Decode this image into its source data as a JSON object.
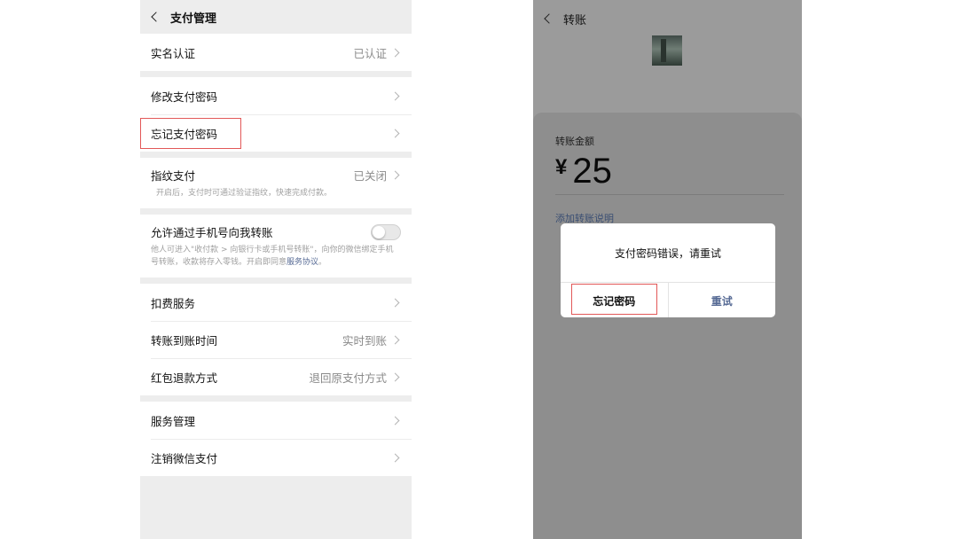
{
  "left": {
    "title": "支付管理",
    "groups": [
      {
        "rows": [
          {
            "label": "实名认证",
            "value": "已认证"
          }
        ]
      },
      {
        "rows": [
          {
            "label": "修改支付密码",
            "value": ""
          },
          {
            "label": "忘记支付密码",
            "value": ""
          }
        ]
      },
      {
        "rows": [
          {
            "label": "指纹支付",
            "value": "已关闭",
            "desc": "开启后，支付时可通过验证指纹，快速完成付款。"
          }
        ]
      },
      {
        "rows": [
          {
            "label": "允许通过手机号向我转账",
            "desc_pre": "他人可进入\"收付款 > 向银行卡或手机号转账\"，向你的微信绑定手机号转账，收款将存入零钱。开启即同意",
            "desc_link": "服务协议",
            "desc_post": "。"
          }
        ]
      },
      {
        "rows": [
          {
            "label": "扣费服务",
            "value": ""
          },
          {
            "label": "转账到账时间",
            "value": "实时到账"
          },
          {
            "label": "红包退款方式",
            "value": "退回原支付方式"
          }
        ]
      },
      {
        "rows": [
          {
            "label": "服务管理",
            "value": ""
          },
          {
            "label": "注销微信支付",
            "value": ""
          }
        ]
      }
    ]
  },
  "right": {
    "title": "转账",
    "amount_label": "转账金额",
    "currency": "¥",
    "amount": "25",
    "note_link": "添加转账说明",
    "dialog": {
      "message": "支付密码错误，请重试",
      "btn_forgot": "忘记密码",
      "btn_retry": "重试"
    }
  },
  "colors": {
    "highlight": "#e25858",
    "link": "#576b95"
  }
}
